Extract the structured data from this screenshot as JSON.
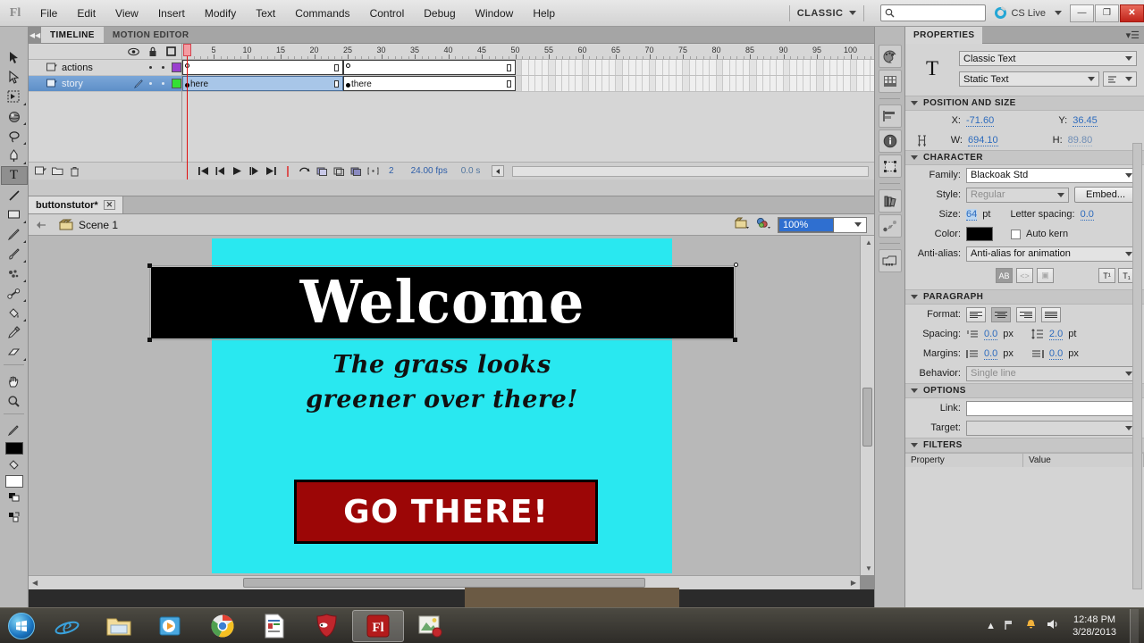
{
  "app": {
    "logo": "Fl",
    "workspace": "CLASSIC",
    "cs_live": "CS Live",
    "search_placeholder": ""
  },
  "menu": {
    "items": [
      "File",
      "Edit",
      "View",
      "Insert",
      "Modify",
      "Text",
      "Commands",
      "Control",
      "Debug",
      "Window",
      "Help"
    ]
  },
  "window_controls": {
    "minimize": "—",
    "maximize": "❐",
    "close": "✕"
  },
  "toolbar": {
    "tools": [
      {
        "name": "selection-tool",
        "glyph": "arrow"
      },
      {
        "name": "subselection-tool",
        "glyph": "arrow-hollow"
      },
      {
        "name": "free-transform-tool",
        "glyph": "transform"
      },
      {
        "name": "3d-rotation-tool",
        "glyph": "sphere"
      },
      {
        "name": "lasso-tool",
        "glyph": "lasso"
      },
      {
        "name": "pen-tool",
        "glyph": "pen"
      },
      {
        "name": "text-tool",
        "glyph": "T",
        "active": true
      },
      {
        "name": "line-tool",
        "glyph": "line"
      },
      {
        "name": "rectangle-tool",
        "glyph": "rect"
      },
      {
        "name": "pencil-tool",
        "glyph": "pencil"
      },
      {
        "name": "brush-tool",
        "glyph": "brush"
      },
      {
        "name": "deco-tool",
        "glyph": "deco"
      },
      {
        "name": "bone-tool",
        "glyph": "bone"
      },
      {
        "name": "paint-bucket-tool",
        "glyph": "bucket"
      },
      {
        "name": "eyedropper-tool",
        "glyph": "dropper"
      },
      {
        "name": "eraser-tool",
        "glyph": "eraser"
      },
      {
        "name": "hand-tool",
        "glyph": "hand"
      },
      {
        "name": "zoom-tool",
        "glyph": "magnifier"
      }
    ],
    "stroke_color": "#000000",
    "fill_color": "#ffffff"
  },
  "timeline": {
    "tabs": [
      {
        "label": "TIMELINE",
        "active": true
      },
      {
        "label": "MOTION EDITOR",
        "active": false
      }
    ],
    "ruler_marks": [
      1,
      5,
      10,
      15,
      20,
      25,
      30,
      35,
      40,
      45,
      50,
      55,
      60,
      65,
      70,
      75,
      80,
      85,
      90,
      95,
      100
    ],
    "playhead_frame": 1,
    "layers": [
      {
        "name": "actions",
        "color": "#9a3fcf",
        "selected": false,
        "locked": false,
        "frame_label": ""
      },
      {
        "name": "story",
        "color": "#33e033",
        "selected": true,
        "locked": false,
        "frame_label_start": "here",
        "frame_label_key": "there"
      }
    ],
    "keyframes": [
      1,
      25
    ],
    "span_end": 50,
    "footer": {
      "current_frame": "2",
      "fps": "24.00 fps",
      "elapsed": "0.0 s"
    }
  },
  "document": {
    "tab_title": "buttonstutor*",
    "scene": "Scene 1",
    "zoom": "100%"
  },
  "stage": {
    "background_color": "#29e8f0",
    "headline": "Welcome",
    "headline_bg": "#000000",
    "headline_color": "#ffffff",
    "body_line1": "The grass looks",
    "body_line2": "greener over there!",
    "button_label": "GO THERE!",
    "button_color": "#9c0606",
    "button_text_color": "#ffffff"
  },
  "right_dock": {
    "icons": [
      {
        "name": "color-panel-icon"
      },
      {
        "name": "swatches-panel-icon"
      },
      {
        "name": "align-panel-icon"
      },
      {
        "name": "info-panel-icon"
      },
      {
        "name": "transform-panel-icon"
      },
      {
        "name": "library-panel-icon"
      },
      {
        "name": "motion-presets-panel-icon"
      },
      {
        "name": "movie-explorer-panel-icon"
      }
    ]
  },
  "properties": {
    "panel_title": "PROPERTIES",
    "instance_icon": "T",
    "text_engine": "Classic Text",
    "text_type": "Static Text",
    "sections": {
      "position_and_size": {
        "title": "POSITION AND SIZE",
        "x_label": "X:",
        "x_value": "-71.60",
        "y_label": "Y:",
        "y_value": "36.45",
        "w_label": "W:",
        "w_value": "694.10",
        "h_label": "H:",
        "h_value": "89.80"
      },
      "character": {
        "title": "CHARACTER",
        "family_label": "Family:",
        "family_value": "Blackoak Std",
        "style_label": "Style:",
        "style_value": "Regular",
        "embed_label": "Embed...",
        "size_label": "Size:",
        "size_value": "64",
        "size_unit": "pt",
        "letter_spacing_label": "Letter spacing:",
        "letter_spacing_value": "0.0",
        "color_label": "Color:",
        "color_value": "#000000",
        "auto_kern_label": "Auto kern",
        "anti_alias_label": "Anti-alias:",
        "anti_alias_value": "Anti-alias for animation"
      },
      "paragraph": {
        "title": "PARAGRAPH",
        "format_label": "Format:",
        "spacing_label": "Spacing:",
        "spacing_indent_value": "0.0",
        "spacing_indent_unit": "px",
        "spacing_line_value": "2.0",
        "spacing_line_unit": "pt",
        "margins_label": "Margins:",
        "margin_left_value": "0.0",
        "margin_left_unit": "px",
        "margin_right_value": "0.0",
        "margin_right_unit": "px",
        "behavior_label": "Behavior:",
        "behavior_value": "Single line"
      },
      "options": {
        "title": "OPTIONS",
        "link_label": "Link:",
        "link_value": "",
        "target_label": "Target:",
        "target_value": ""
      },
      "filters": {
        "title": "FILTERS",
        "col_property": "Property",
        "col_value": "Value"
      }
    }
  },
  "taskbar": {
    "items": [
      {
        "name": "internet-explorer",
        "glyph": "e"
      },
      {
        "name": "windows-explorer",
        "glyph": "folder"
      },
      {
        "name": "windows-media-player",
        "glyph": "media"
      },
      {
        "name": "google-chrome",
        "glyph": "chrome"
      },
      {
        "name": "document-app",
        "glyph": "doc"
      },
      {
        "name": "security-app",
        "glyph": "shield"
      },
      {
        "name": "adobe-flash",
        "glyph": "Fl",
        "active": true
      },
      {
        "name": "photo-app",
        "glyph": "photo"
      }
    ],
    "clock_time": "12:48 PM",
    "clock_date": "3/28/2013"
  }
}
